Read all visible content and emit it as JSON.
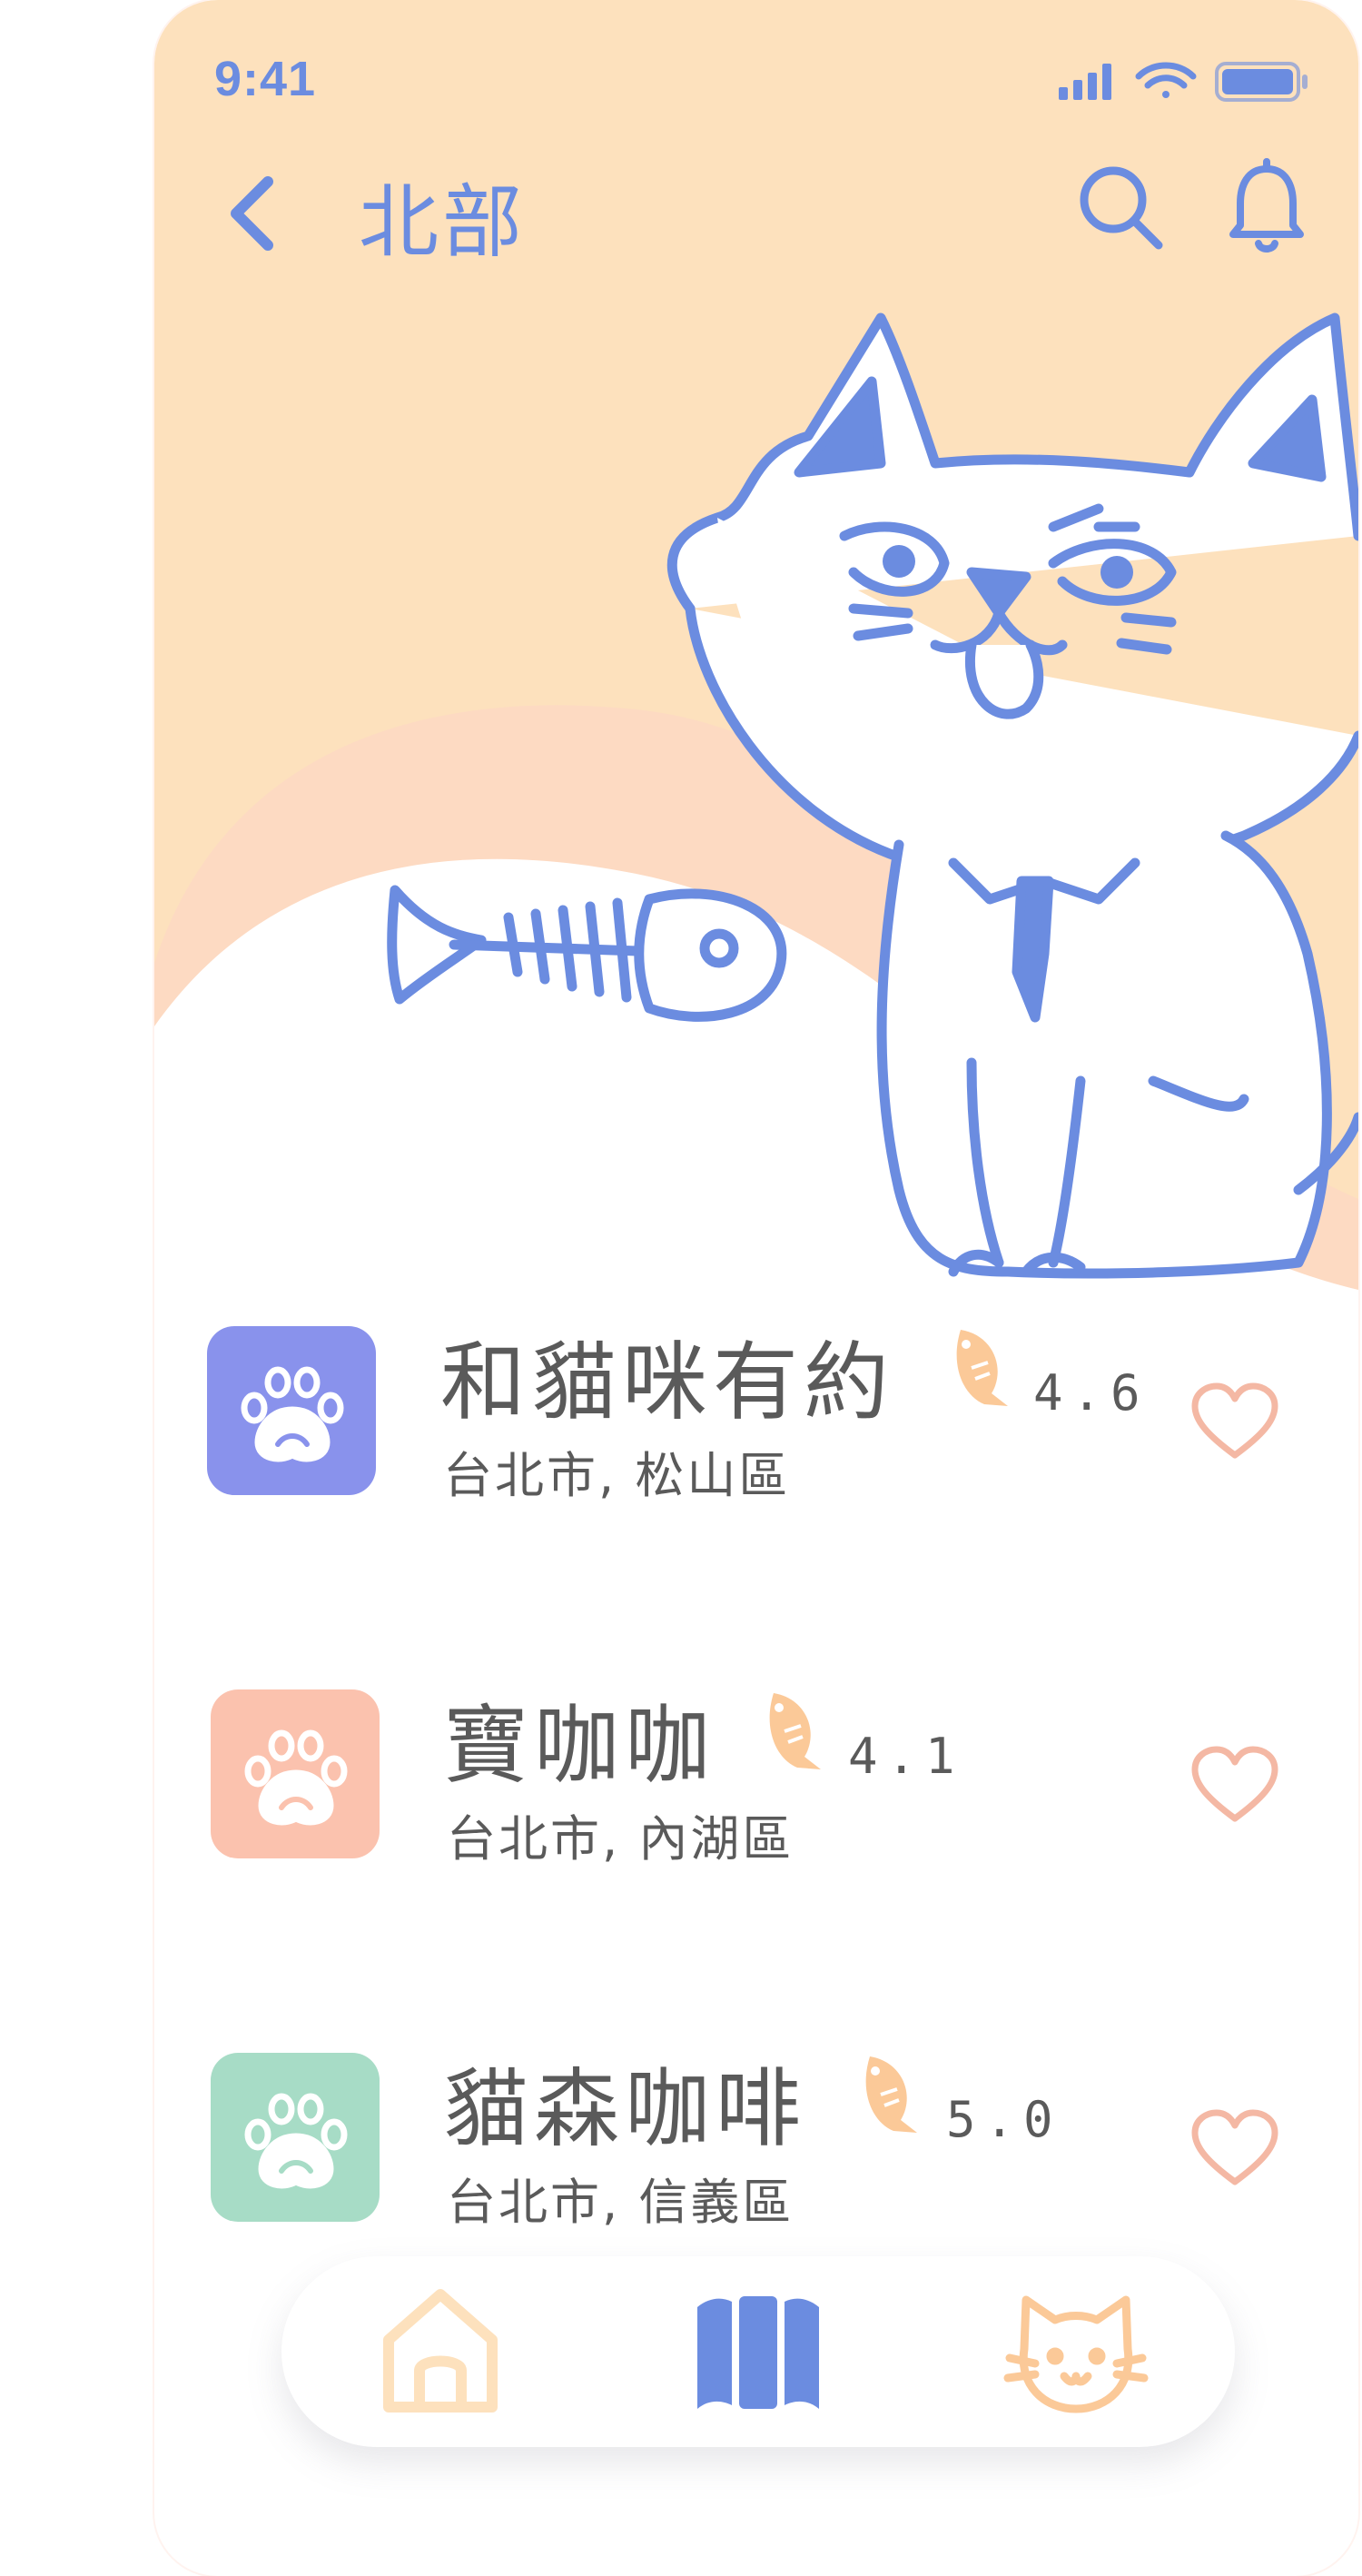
{
  "status_bar": {
    "time": "9:41"
  },
  "header": {
    "title": "北部"
  },
  "cafes": [
    {
      "name": "和貓咪有約",
      "rating": "4.6",
      "location": "台北市, 松山區",
      "icon_color": "#8992ec"
    },
    {
      "name": "寶咖咖",
      "rating": "4.1",
      "location": "台北市, 內湖區",
      "icon_color": "#fbc2ae"
    },
    {
      "name": "貓森咖啡",
      "rating": "5.0",
      "location": "台北市, 信義區",
      "icon_color": "#a7dcc6"
    }
  ],
  "tabbar": {
    "tabs": [
      "home-icon",
      "map-icon",
      "cat-icon"
    ]
  },
  "colors": {
    "primary": "#6b8ce0",
    "hero_bg": "#fde1bd",
    "wave": "#fddac2",
    "heart": "#f4b8a4",
    "fish": "#fbc998",
    "text": "#5a5a5a"
  }
}
